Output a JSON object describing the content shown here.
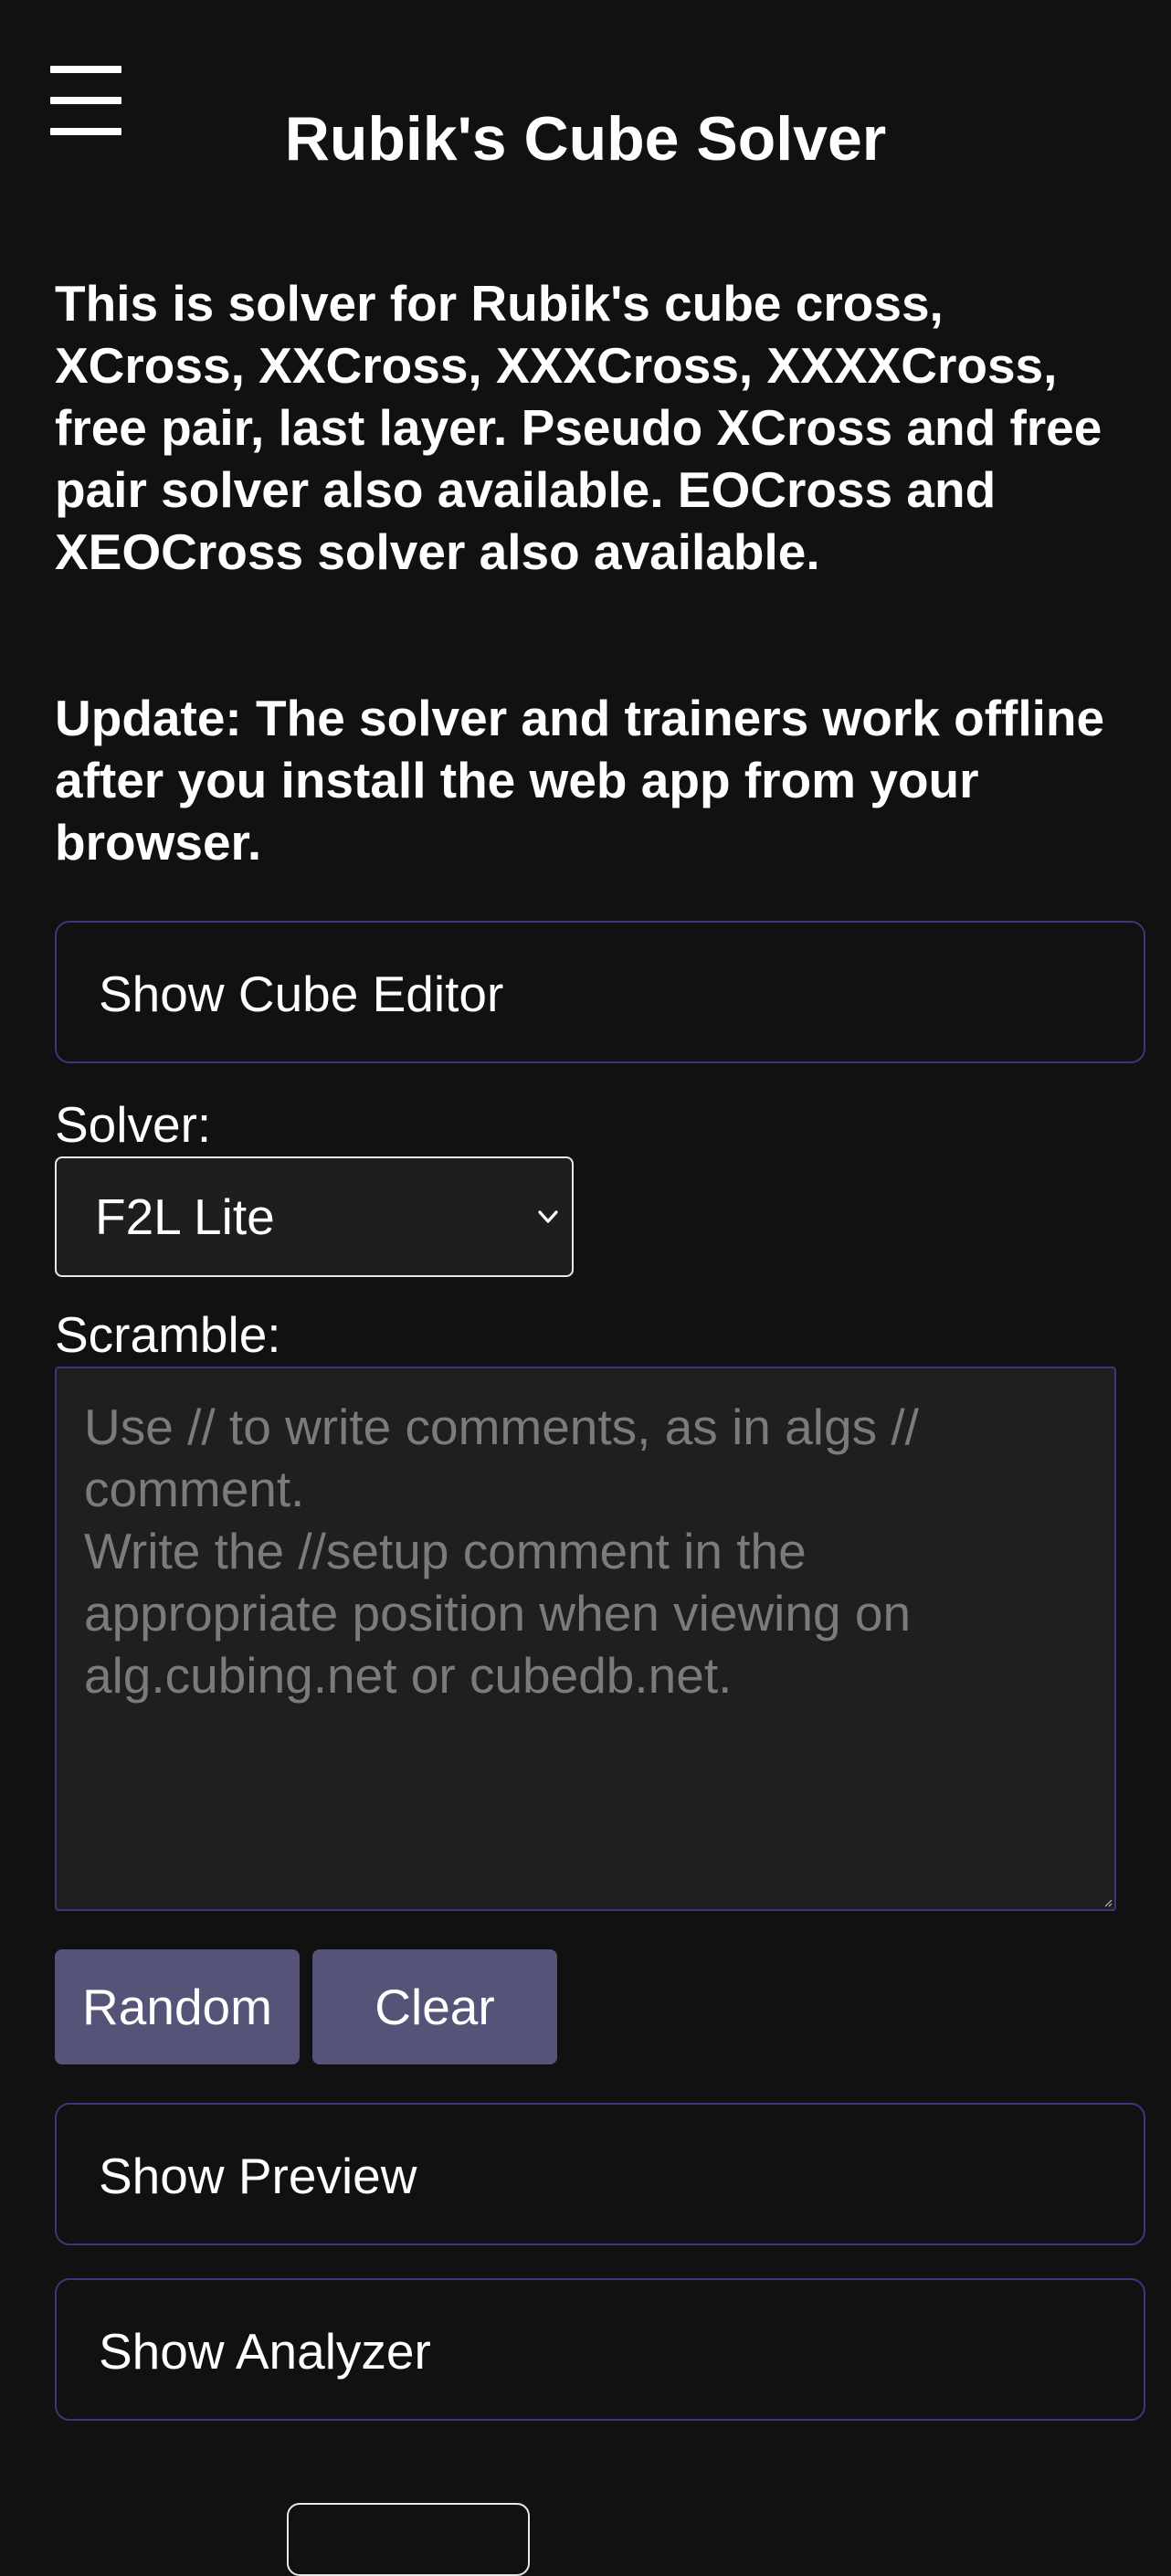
{
  "header": {
    "menu_icon": "hamburger-menu-icon",
    "title": "Rubik's Cube Solver"
  },
  "intro": {
    "description": "This is solver for Rubik's cube cross, XCross, XXCross, XXXCross, XXXXCross, free pair, last layer. Pseudo XCross and free pair solver also available. EOCross and XEOCross solver also available.",
    "update": "Update: The solver and trainers work offline after you install the web app from your browser."
  },
  "editor": {
    "toggle_label": "Show Cube Editor"
  },
  "solver": {
    "label": "Solver:",
    "selected": "F2L Lite"
  },
  "scramble": {
    "label": "Scramble:",
    "placeholder_lines": [
      "Use // to write comments, as in algs //",
      "comment.",
      "Write the //setup comment in the",
      "appropriate position when viewing on",
      "alg.cubing.net or cubedb.net."
    ]
  },
  "actions": {
    "random_label": "Random",
    "clear_label": "Clear"
  },
  "preview": {
    "toggle_label": "Show Preview"
  },
  "analyzer": {
    "toggle_label": "Show Analyzer"
  },
  "colors": {
    "background": "#111112",
    "panel_border": "#3f3577",
    "button_fill": "#565379",
    "placeholder_text": "#7b7b7b"
  }
}
